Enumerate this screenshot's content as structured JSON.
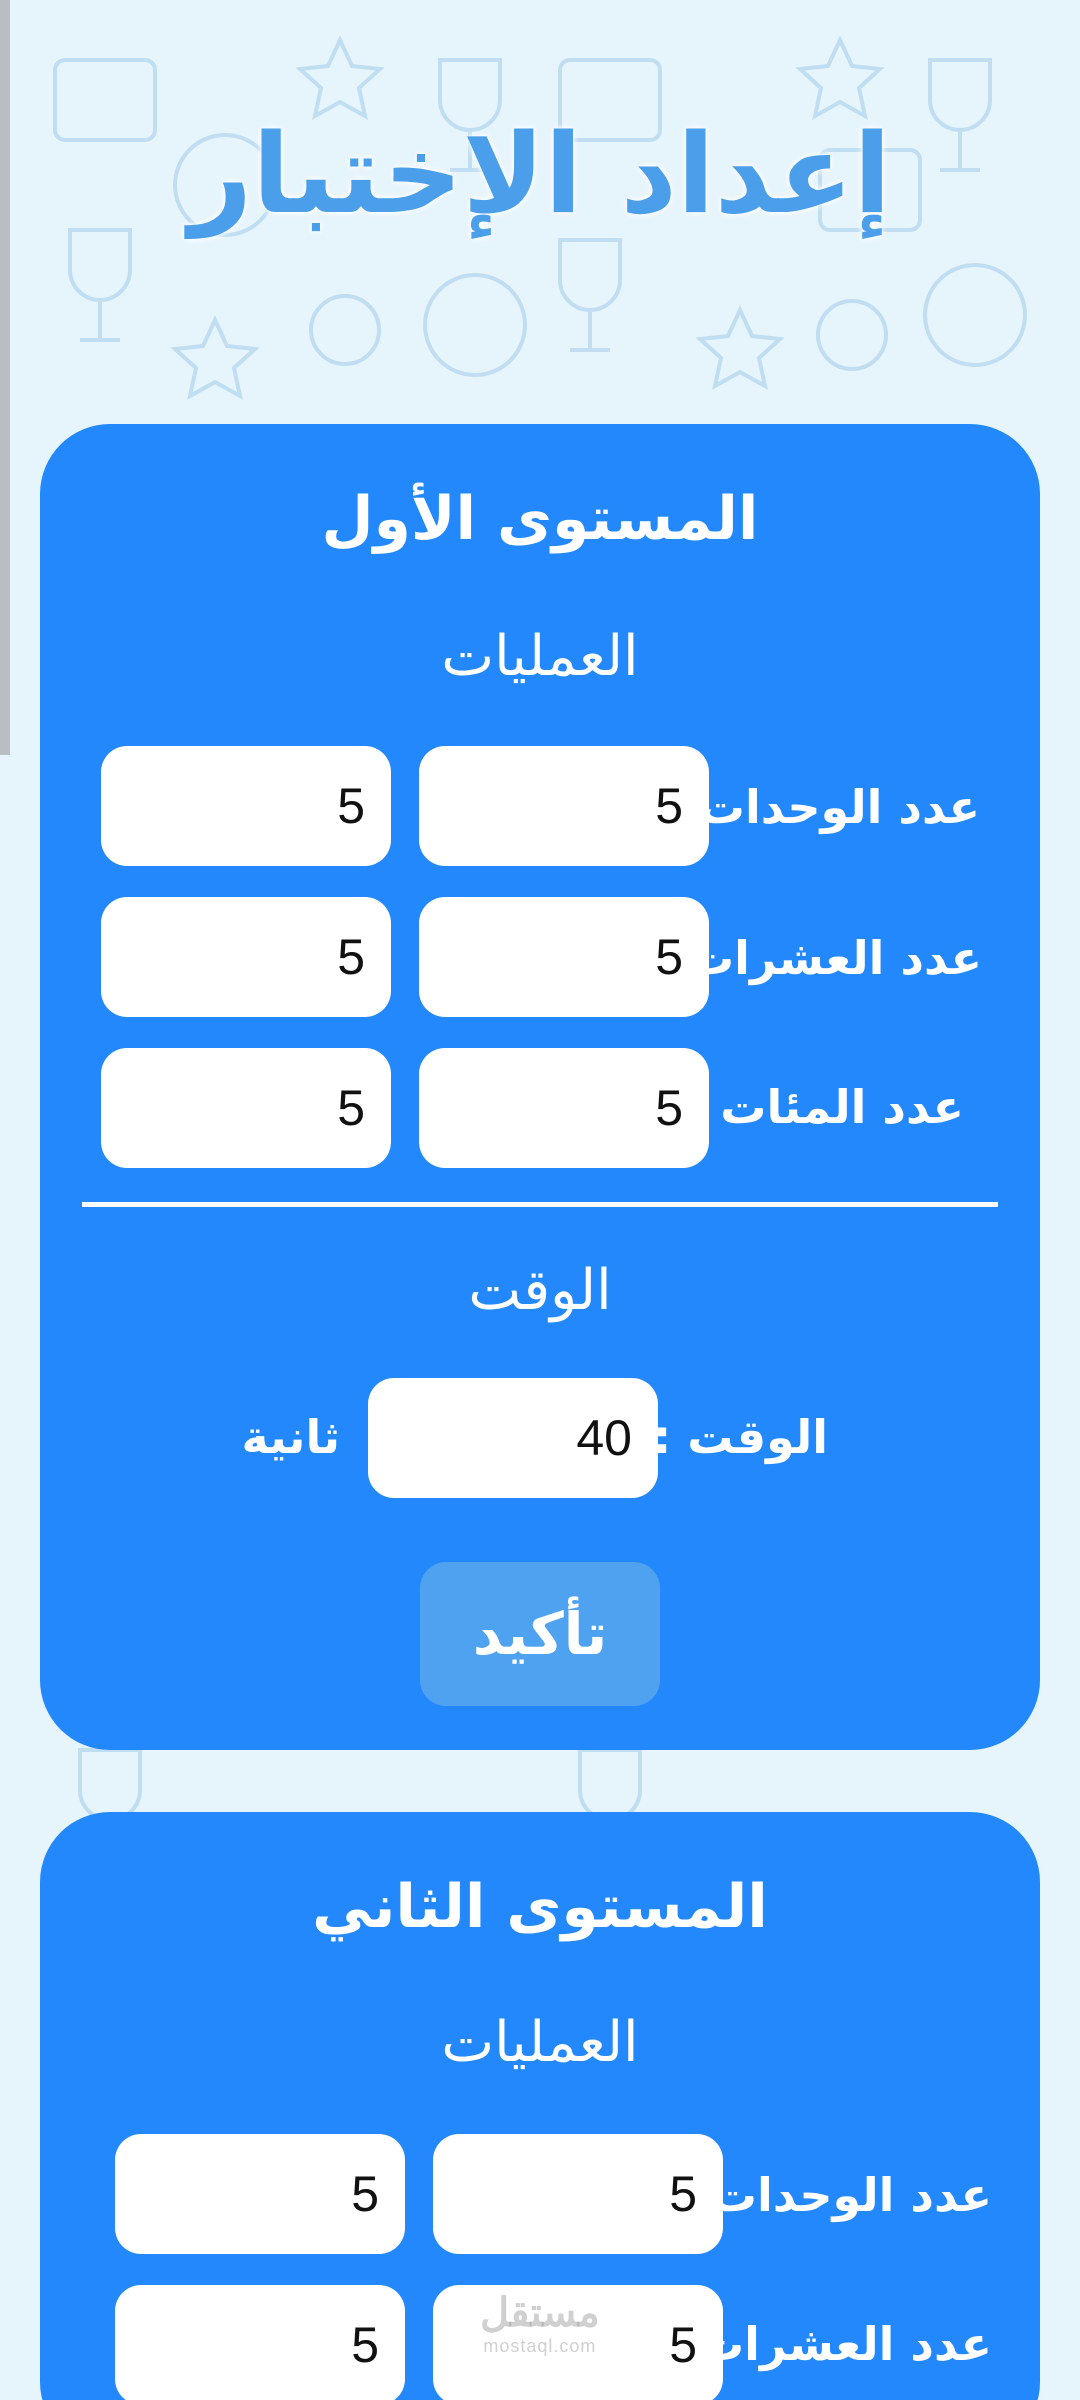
{
  "page": {
    "title": "إعداد الإختبار"
  },
  "levels": [
    {
      "title": "المستوى الأول",
      "operations_title": "العمليات",
      "rows": [
        {
          "label": "عدد الوحدات",
          "value_a": "5",
          "value_b": "5"
        },
        {
          "label": "عدد العشرات",
          "value_a": "5",
          "value_b": "5"
        },
        {
          "label": "عدد المئات",
          "value_a": "5",
          "value_b": "5"
        }
      ],
      "time_title": "الوقت",
      "time_label": "الوقت :",
      "time_value": "40",
      "time_unit": "ثانية",
      "confirm_label": "تأكيد"
    },
    {
      "title": "المستوى الثاني",
      "operations_title": "العمليات",
      "rows": [
        {
          "label": "عدد الوحدات",
          "value_a": "5",
          "value_b": "5"
        },
        {
          "label": "عدد العشرات",
          "value_a": "5",
          "value_b": "5"
        }
      ]
    }
  ],
  "watermark": {
    "arabic": "مستقل",
    "latin": "mostaql.com"
  },
  "colors": {
    "card": "#2288fc",
    "title": "#4a9eea",
    "background": "#e6f4fc",
    "button": "#4ea2ef"
  }
}
